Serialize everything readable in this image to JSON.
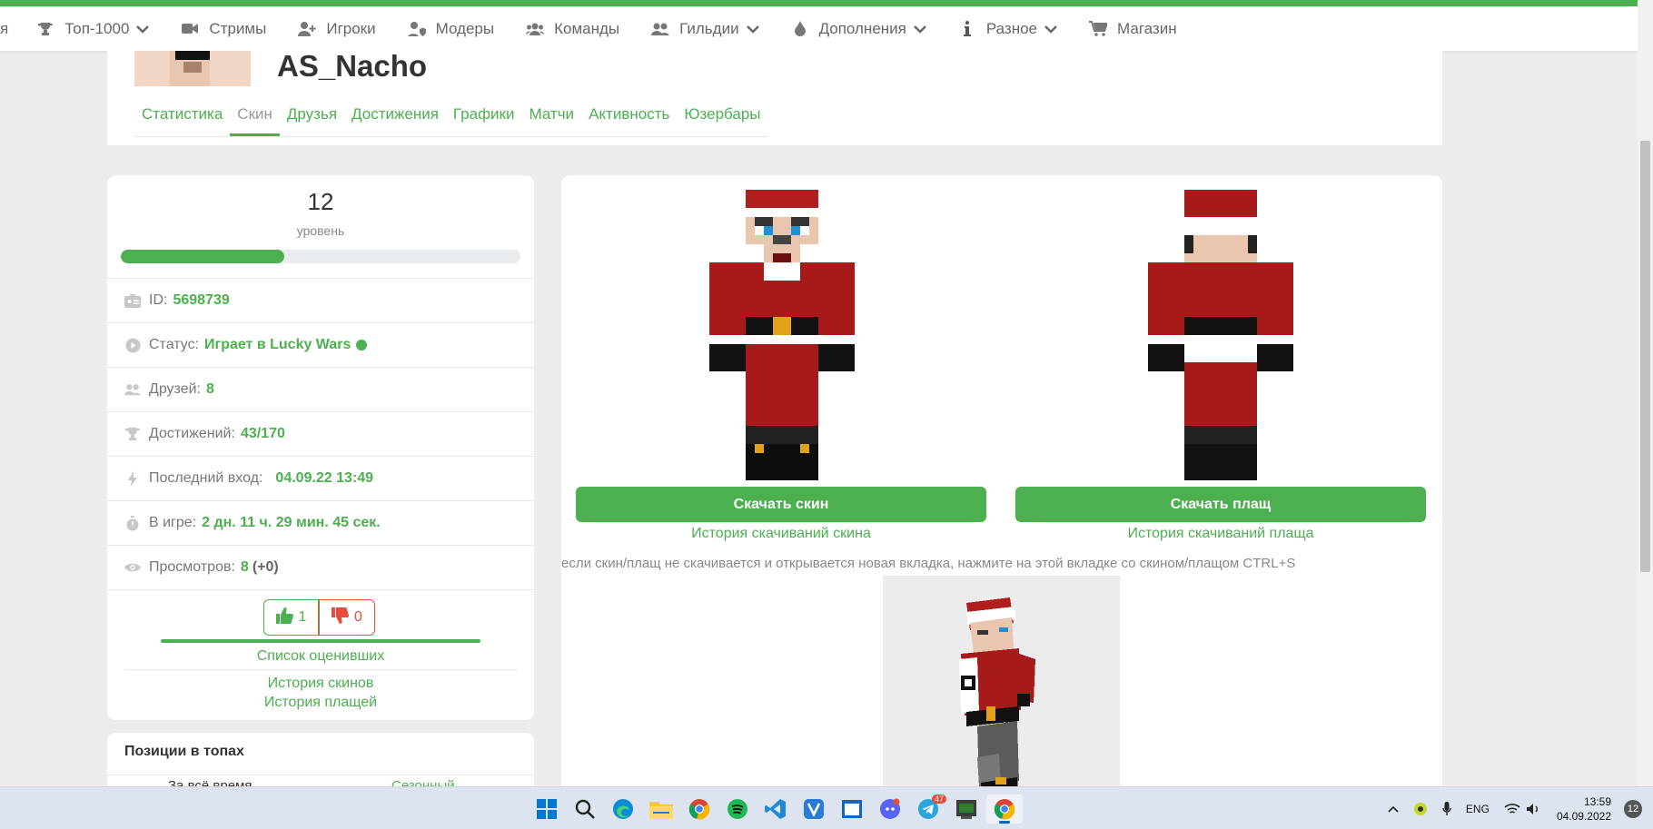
{
  "nav": {
    "cut_label": "я",
    "items": [
      {
        "label": "Топ-1000",
        "icon": "trophy-icon",
        "dropdown": true
      },
      {
        "label": "Стримы",
        "icon": "video-camera-icon",
        "dropdown": false
      },
      {
        "label": "Игроки",
        "icon": "user-plus-icon",
        "dropdown": false
      },
      {
        "label": "Модеры",
        "icon": "user-shield-icon",
        "dropdown": false
      },
      {
        "label": "Команды",
        "icon": "users-icon",
        "dropdown": false
      },
      {
        "label": "Гильдии",
        "icon": "user-group-icon",
        "dropdown": true
      },
      {
        "label": "Дополнения",
        "icon": "droplet-icon",
        "dropdown": true
      },
      {
        "label": "Разное",
        "icon": "info-icon",
        "dropdown": true
      },
      {
        "label": "Магазин",
        "icon": "cart-icon",
        "dropdown": false
      }
    ]
  },
  "profile": {
    "username": "AS_Nacho",
    "tabs": [
      "Статистика",
      "Скин",
      "Друзья",
      "Достижения",
      "Графики",
      "Матчи",
      "Активность",
      "Юзербары"
    ],
    "active_tab": "Скин"
  },
  "stats": {
    "level": "12",
    "level_label": "уровень",
    "level_progress": 0.41,
    "id_label": "ID:",
    "id_value": "5698739",
    "status_label": "Статус:",
    "status_value": "Играет в Lucky Wars",
    "friends_label": "Друзей:",
    "friends_value": "8",
    "achievements_label": "Достижений:",
    "achievements_value": "43/170",
    "last_login_label": "Последний вход:",
    "last_login_value": "04.09.22 13:49",
    "playtime_label": "В игре:",
    "playtime_value": "2 дн. 11 ч. 29 мин. 45 сек.",
    "views_label": "Просмотров:",
    "views_value": "8",
    "views_delta": "(+0)",
    "likes": "1",
    "dislikes": "0",
    "raters_link": "Список оценивших",
    "skins_history_link": "История скинов",
    "capes_history_link": "История плащей"
  },
  "tops": {
    "title": "Позиции в топах",
    "col_all_time": "За всё время",
    "col_seasonal": "Сезонный"
  },
  "skin": {
    "download_skin": "Скачать скин",
    "download_cape": "Скачать плащ",
    "skin_history": "История скачиваний скина",
    "cape_history": "История скачиваний плаща",
    "note": "если скин/плащ не скачивается и открывается новая вкладка, нажмите на этой вкладке со скином/плащом CTRL+S"
  },
  "taskbar": {
    "apps": [
      "windows-start-icon",
      "search-icon",
      "edge-icon",
      "file-explorer-icon",
      "chrome-icon",
      "spotify-icon",
      "vscode-icon",
      "vivaldi-icon",
      "window-app-icon",
      "discord-icon",
      "telegram-icon",
      "terminal-icon",
      "chrome-icon"
    ],
    "telegram_badge": "47",
    "lang": "ENG",
    "time": "13:59",
    "date": "04.09.2022",
    "notifications": "12"
  },
  "colors": {
    "accent": "#4caf50",
    "danger": "#e74c3c"
  }
}
